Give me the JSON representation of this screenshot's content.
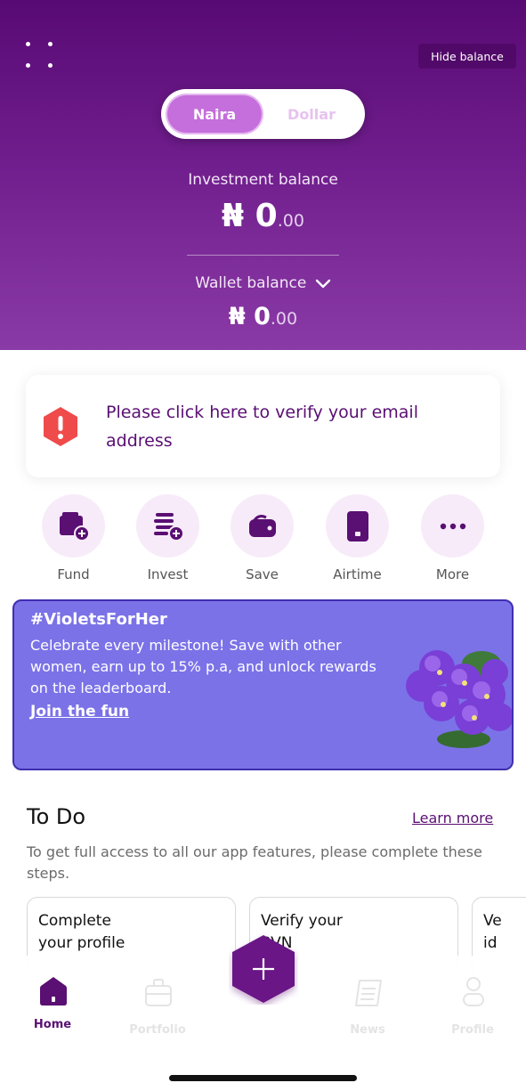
{
  "colors": {
    "brand_purple": "#6f1d8c",
    "accent_pink": "#c46fdb",
    "alert_red": "#ef4b4b",
    "banner_bg": "#7b72e8"
  },
  "header": {
    "hide_balance_label": "Hide balance",
    "currency_toggle": {
      "options": [
        "Naira",
        "Dollar"
      ],
      "selected": "Naira"
    },
    "investment": {
      "label": "Investment balance",
      "currency_symbol": "₦",
      "whole": "0",
      "decimal": ".00"
    },
    "wallet": {
      "label": "Wallet balance",
      "currency_symbol": "₦",
      "whole": "0",
      "decimal": ".00"
    }
  },
  "verify_email": {
    "text": "Please click here to verify your email address",
    "icon": "alert-icon"
  },
  "actions": [
    {
      "label": "Fund",
      "icon": "wallet-plus-icon"
    },
    {
      "label": "Invest",
      "icon": "coins-plus-icon"
    },
    {
      "label": "Save",
      "icon": "piggy-wallet-icon"
    },
    {
      "label": "Airtime",
      "icon": "phone-icon"
    },
    {
      "label": "More",
      "icon": "more-dots-icon"
    }
  ],
  "banner": {
    "title": "#VioletsForHer",
    "text": "Celebrate every milestone! Save with other women, earn up to 15% p.a, and unlock rewards on the leaderboard.",
    "link": "Join the fun"
  },
  "todo": {
    "title": "To Do",
    "learn_more": "Learn more",
    "description": "To get full access to all our app features, please complete these steps.",
    "cards": [
      {
        "line1": "Complete",
        "line2": "your profile"
      },
      {
        "line1": "Verify your",
        "line2": "BVN"
      },
      {
        "line1": "Ve",
        "line2": "id"
      }
    ]
  },
  "bottom_nav": {
    "items": [
      {
        "label": "Home",
        "icon": "home-icon",
        "active": true
      },
      {
        "label": "Portfolio",
        "icon": "briefcase-icon",
        "active": false
      },
      {
        "label": "News",
        "icon": "news-icon",
        "active": false
      },
      {
        "label": "Profile",
        "icon": "profile-icon",
        "active": false
      }
    ],
    "fab_icon": "plus-icon"
  }
}
